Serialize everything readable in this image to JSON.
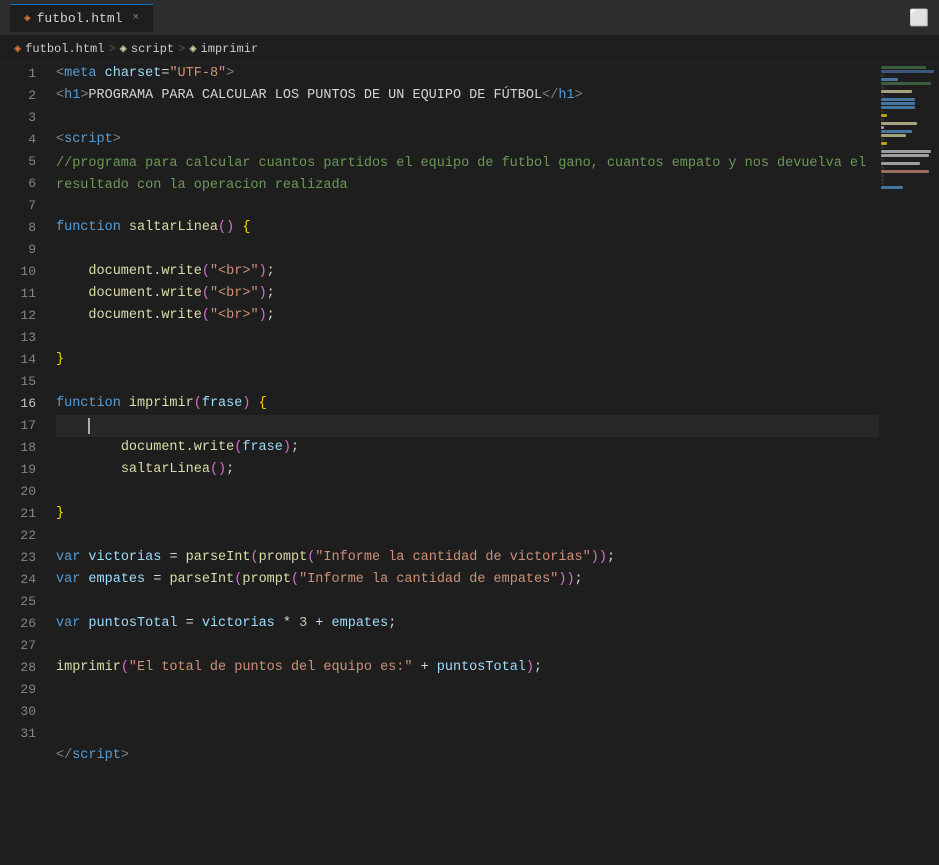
{
  "titleBar": {
    "tab": {
      "filename": "futbol.html",
      "closeSymbol": "×"
    },
    "windowControl": "⬜"
  },
  "breadcrumb": {
    "items": [
      {
        "label": "futbol.html",
        "icon": "◈"
      },
      {
        "label": "script",
        "icon": "◈"
      },
      {
        "label": "imprimir",
        "icon": "◈"
      }
    ],
    "separators": [
      ">",
      ">"
    ]
  },
  "lines": [
    {
      "num": 1,
      "content": "meta_charset"
    },
    {
      "num": 2,
      "content": "h1_tag"
    },
    {
      "num": 3,
      "content": "empty"
    },
    {
      "num": 4,
      "content": "script_open"
    },
    {
      "num": 5,
      "content": "comment_line"
    },
    {
      "num": 6,
      "content": "empty"
    },
    {
      "num": 7,
      "content": "fn_saltarLinea"
    },
    {
      "num": 8,
      "content": "empty"
    },
    {
      "num": 9,
      "content": "doc_write1"
    },
    {
      "num": 10,
      "content": "doc_write2"
    },
    {
      "num": 11,
      "content": "doc_write3"
    },
    {
      "num": 12,
      "content": "empty"
    },
    {
      "num": 13,
      "content": "close_brace"
    },
    {
      "num": 14,
      "content": "empty"
    },
    {
      "num": 15,
      "content": "fn_imprimir"
    },
    {
      "num": 16,
      "content": "cursor_line"
    },
    {
      "num": 17,
      "content": "doc_write_frase"
    },
    {
      "num": 18,
      "content": "saltarLinea_call"
    },
    {
      "num": 19,
      "content": "empty"
    },
    {
      "num": 20,
      "content": "close_brace2"
    },
    {
      "num": 21,
      "content": "empty"
    },
    {
      "num": 22,
      "content": "var_victorias"
    },
    {
      "num": 23,
      "content": "var_empates"
    },
    {
      "num": 24,
      "content": "empty"
    },
    {
      "num": 25,
      "content": "var_puntosTotal"
    },
    {
      "num": 26,
      "content": "empty"
    },
    {
      "num": 27,
      "content": "imprimir_call"
    },
    {
      "num": 28,
      "content": "empty"
    },
    {
      "num": 29,
      "content": "empty"
    },
    {
      "num": 30,
      "content": "empty"
    },
    {
      "num": 31,
      "content": "script_close"
    }
  ]
}
